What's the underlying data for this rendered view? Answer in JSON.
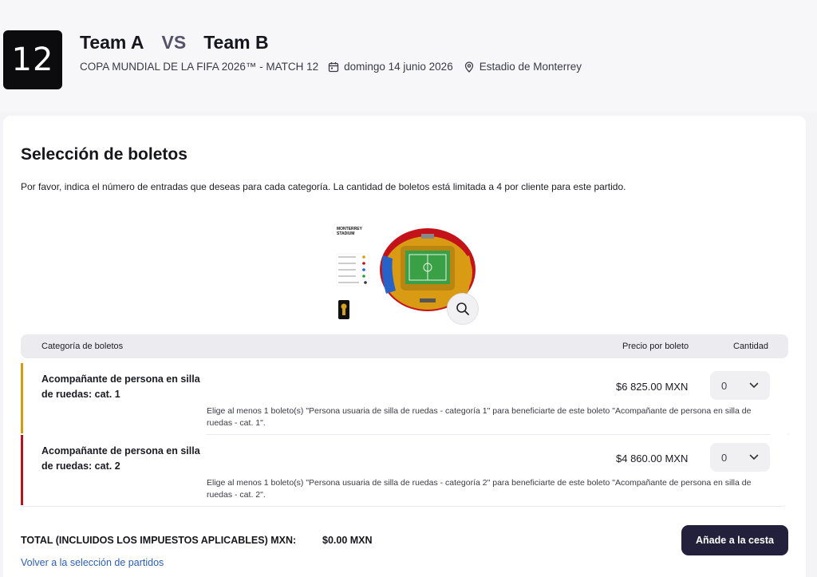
{
  "header": {
    "match_number": "12",
    "team_home": "Team A",
    "vs": "VS",
    "team_away": "Team B",
    "competition": "COPA MUNDIAL DE LA FIFA 2026™ - MATCH 12",
    "date": "domingo 14 junio 2026",
    "venue": "Estadio de Monterrey",
    "icons": {
      "date": "calendar-icon",
      "venue": "location-pin-icon"
    }
  },
  "selection": {
    "title": "Selección de boletos",
    "instructions": "Por favor, indica el número de entradas que deseas para cada categoría. La cantidad de boletos está limitada a 4 por cliente para este partido."
  },
  "map": {
    "stadium_label_line1": "MONTERREY",
    "stadium_label_line2": "STADIUM",
    "zoom_icon": "magnifier-icon"
  },
  "table": {
    "col_category": "Categoría de boletos",
    "col_price": "Precio por boleto",
    "col_quantity": "Cantidad",
    "rows": [
      {
        "name": "Acompañante de persona en silla de ruedas: cat. 1",
        "price": "$6 825.00 MXN",
        "quantity": "0",
        "note": "Elige al menos 1 boleto(s) \"Persona usuaria de silla de ruedas - categoría 1\" para beneficiarte de este boleto \"Acompañante de persona en silla de ruedas - cat. 1\".",
        "color": "#d39a0c"
      },
      {
        "name": "Acompañante de persona en silla de ruedas: cat. 2",
        "price": "$4 860.00 MXN",
        "quantity": "0",
        "note": "Elige al menos 1 boleto(s) \"Persona usuaria de silla de ruedas - categoría 2\" para beneficiarte de este boleto \"Acompañante de persona en silla de ruedas - cat. 2\".",
        "color": "#b8131c"
      }
    ]
  },
  "footer": {
    "total_label": "TOTAL (INCLUIDOS LOS IMPUESTOS APLICABLES) MXN:",
    "total_value": "$0.00 MXN",
    "back_link": "Volver a la selección de partidos",
    "add_button": "Añade a la cesta"
  },
  "colors": {
    "primary_button": "#22203a",
    "link": "#2b5fb8",
    "category_1": "#d39a0c",
    "category_2": "#b8131c"
  }
}
